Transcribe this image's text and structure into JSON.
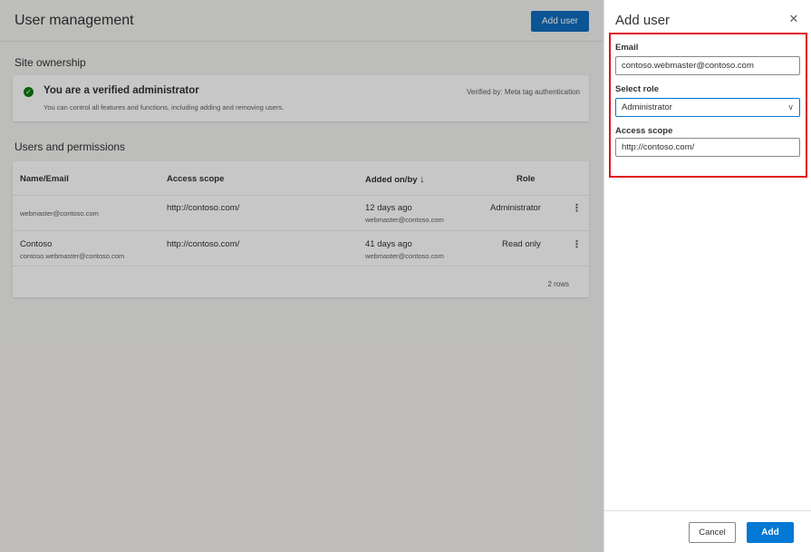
{
  "header": {
    "title": "User management",
    "add_user_label": "Add user"
  },
  "ownership": {
    "section_title": "Site ownership",
    "verified_title": "You are a verified administrator",
    "verified_subtitle": "You can control all features and functions, including adding and removing users.",
    "verified_by": "Verified by: Meta tag authentication",
    "check_icon": "check-circle-icon"
  },
  "users": {
    "section_title": "Users and permissions",
    "columns": [
      "Name/Email",
      "Access scope",
      "Added on/by",
      "Role"
    ],
    "sort_arrow": "↓",
    "rows": [
      {
        "name": "",
        "email": "webmaster@contoso.com",
        "scope": "http://contoso.com/",
        "added": "12 days ago",
        "by": "webmaster@contoso.com",
        "role": "Administrator",
        "more": "⋮"
      },
      {
        "name": "Contoso",
        "email": "contoso.webmaster@contoso.com",
        "scope": "http://contoso.com/",
        "added": "41 days ago",
        "by": "webmaster@contoso.com",
        "role": "Read only",
        "more": "⋮"
      }
    ],
    "row_count": "2 rows"
  },
  "panel": {
    "title": "Add user",
    "close_glyph": "✕",
    "email_label": "Email",
    "email_value": "contoso.webmaster@contoso.com",
    "role_label": "Select role",
    "role_value": "Administrator",
    "chevron_glyph": "∨",
    "scope_label": "Access scope",
    "scope_value": "http://contoso.com/",
    "cancel_label": "Cancel",
    "add_label": "Add"
  },
  "colors": {
    "accent": "#0078d4",
    "highlight": "#e0111a",
    "verified": "#107c10"
  }
}
